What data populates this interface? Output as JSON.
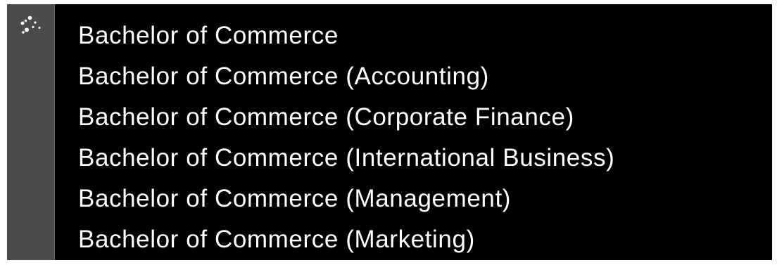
{
  "rail": {
    "icon": "scatter-dots-icon"
  },
  "list": {
    "items": [
      {
        "label": "Bachelor of Commerce"
      },
      {
        "label": "Bachelor of Commerce (Accounting)"
      },
      {
        "label": "Bachelor of Commerce (Corporate Finance)"
      },
      {
        "label": "Bachelor of Commerce (International Business)"
      },
      {
        "label": "Bachelor of Commerce (Management)"
      },
      {
        "label": "Bachelor of Commerce (Marketing)"
      }
    ]
  },
  "colors": {
    "background": "#000000",
    "rail": "#4b4b4b",
    "text": "#ffffff"
  }
}
